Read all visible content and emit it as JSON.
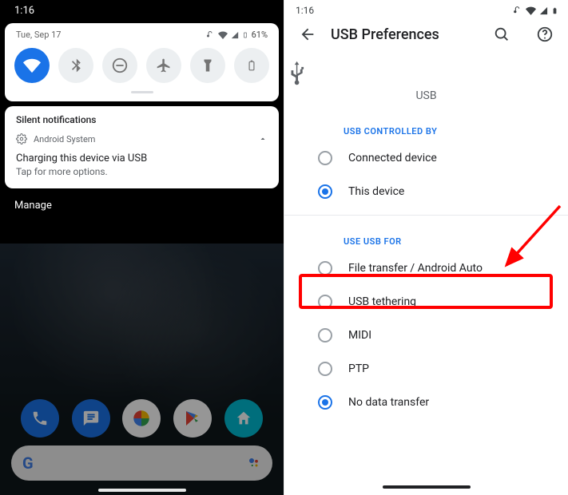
{
  "left": {
    "status_time": "1:16",
    "qs_date": "Tue, Sep 17",
    "battery_text": "61%",
    "toggles": {
      "wifi": "wifi",
      "bluetooth": "bluetooth",
      "dnd": "dnd",
      "airplane": "airplane",
      "flashlight": "flashlight",
      "battery": "battery"
    },
    "silent_section": "Silent notifications",
    "notif_app": "Android System",
    "notif_title": "Charging this device via USB",
    "notif_sub": "Tap for more options.",
    "manage": "Manage"
  },
  "right": {
    "status_time": "1:16",
    "title": "USB Preferences",
    "hero_label": "USB",
    "section_controlled": "USB CONTROLLED BY",
    "option_connected": "Connected device",
    "option_this": "This device",
    "section_use": "USE USB FOR",
    "option_file": "File transfer / Android Auto",
    "option_tether": "USB tethering",
    "option_midi": "MIDI",
    "option_ptp": "PTP",
    "option_nodata": "No data transfer"
  }
}
